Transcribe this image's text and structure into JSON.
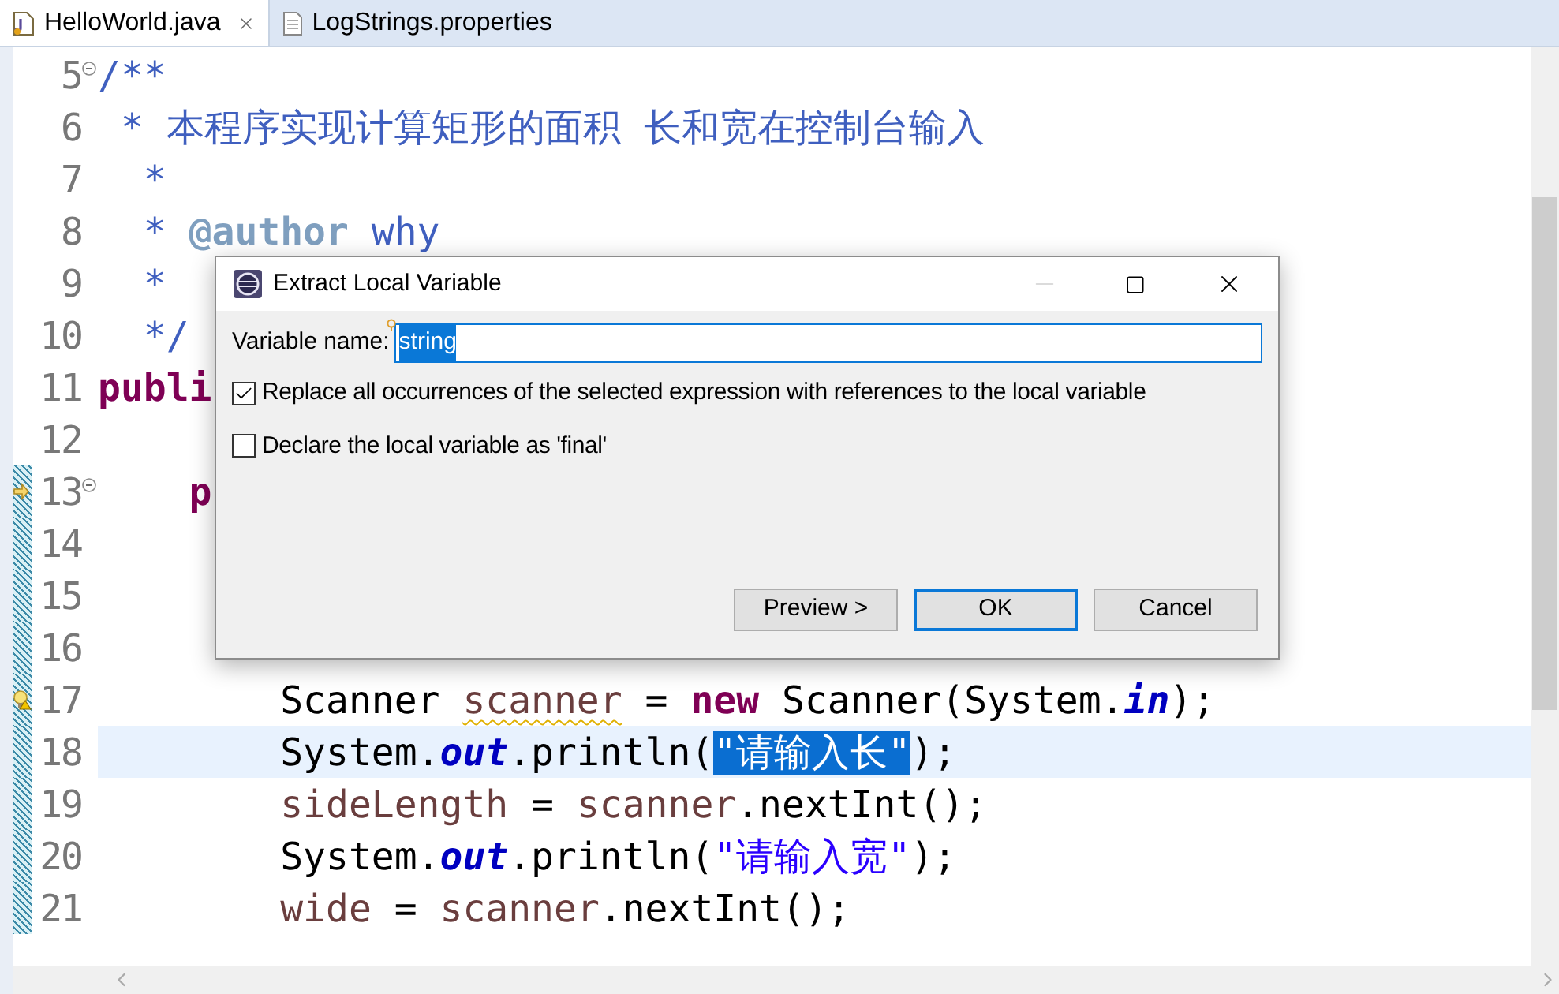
{
  "tabs": [
    {
      "label": "HelloWorld.java",
      "selected": true,
      "kind": "java",
      "closable": true
    },
    {
      "label": "LogStrings.properties",
      "selected": false,
      "kind": "properties",
      "closable": false
    }
  ],
  "editor": {
    "lines": [
      {
        "number": "5",
        "kind": "plain",
        "fold": true,
        "changed": false,
        "current": false,
        "tokens": [
          {
            "text": "/**",
            "kind": "javadoc"
          }
        ]
      },
      {
        "number": "6",
        "kind": "plain",
        "fold": false,
        "changed": false,
        "current": false,
        "tokens": [
          {
            "text": " * 本程序实现计算矩形的面积 长和宽在控制台输入",
            "kind": "javadoc"
          }
        ]
      },
      {
        "number": "7",
        "kind": "plain",
        "fold": false,
        "changed": false,
        "current": false,
        "tokens": [
          {
            "text": "  *",
            "kind": "javadoc"
          }
        ]
      },
      {
        "number": "8",
        "kind": "plain",
        "fold": false,
        "changed": false,
        "current": false,
        "tokens": [
          {
            "text": "  * ",
            "kind": "javadoc"
          },
          {
            "text": "@author",
            "kind": "tag"
          },
          {
            "text": " why",
            "kind": "javadoc"
          }
        ]
      },
      {
        "number": "9",
        "kind": "plain",
        "fold": false,
        "changed": false,
        "current": false,
        "tokens": [
          {
            "text": "  *",
            "kind": "javadoc"
          }
        ]
      },
      {
        "number": "10",
        "kind": "plain",
        "fold": false,
        "changed": false,
        "current": false,
        "tokens": [
          {
            "text": "  */",
            "kind": "javadoc"
          }
        ]
      },
      {
        "number": "11",
        "kind": "plain",
        "fold": false,
        "changed": false,
        "current": false,
        "tokens": [
          {
            "text": "publi",
            "kind": "keyword"
          }
        ]
      },
      {
        "number": "12",
        "kind": "plain",
        "fold": false,
        "changed": false,
        "current": false
      },
      {
        "number": "13",
        "kind": "arrow",
        "fold": true,
        "changed": true,
        "current": false,
        "tokens": [
          {
            "text": "    p",
            "kind": "keyword"
          }
        ]
      },
      {
        "number": "14",
        "kind": "plain",
        "fold": false,
        "changed": true,
        "current": false
      },
      {
        "number": "15",
        "kind": "plain",
        "fold": false,
        "changed": true,
        "current": false
      },
      {
        "number": "16",
        "kind": "plain",
        "fold": false,
        "changed": true,
        "current": false
      },
      {
        "number": "17",
        "kind": "warning",
        "fold": false,
        "changed": true,
        "current": false,
        "tokens": [
          {
            "text": "        Scanner ",
            "kind": "plain"
          },
          {
            "text": "scanner",
            "kind": "local",
            "warning": true
          },
          {
            "text": " = ",
            "kind": "plain"
          },
          {
            "text": "new",
            "kind": "keyword"
          },
          {
            "text": " Scanner(System.",
            "kind": "plain"
          },
          {
            "text": "in",
            "kind": "field"
          },
          {
            "text": ");",
            "kind": "plain"
          }
        ]
      },
      {
        "number": "18",
        "kind": "plain",
        "fold": false,
        "changed": true,
        "current": true,
        "tokens": [
          {
            "text": "        System.",
            "kind": "plain"
          },
          {
            "text": "out",
            "kind": "field"
          },
          {
            "text": ".println(",
            "kind": "plain"
          },
          {
            "text": "\"请输入长\"",
            "kind": "string",
            "selected": true
          },
          {
            "text": ");",
            "kind": "plain"
          }
        ]
      },
      {
        "number": "19",
        "kind": "plain",
        "fold": false,
        "changed": true,
        "current": false,
        "tokens": [
          {
            "text": "        sideLength",
            "kind": "local"
          },
          {
            "text": " = ",
            "kind": "plain"
          },
          {
            "text": "scanner",
            "kind": "local"
          },
          {
            "text": ".nextInt();",
            "kind": "plain"
          }
        ]
      },
      {
        "number": "20",
        "kind": "plain",
        "fold": false,
        "changed": true,
        "current": false,
        "tokens": [
          {
            "text": "        System.",
            "kind": "plain"
          },
          {
            "text": "out",
            "kind": "field"
          },
          {
            "text": ".println(",
            "kind": "plain"
          },
          {
            "text": "\"请输入宽\"",
            "kind": "string"
          },
          {
            "text": ");",
            "kind": "plain"
          }
        ]
      },
      {
        "number": "21",
        "kind": "plain",
        "fold": false,
        "changed": true,
        "current": false,
        "tokens": [
          {
            "text": "        wide",
            "kind": "local"
          },
          {
            "text": " = ",
            "kind": "plain"
          },
          {
            "text": "scanner",
            "kind": "local"
          },
          {
            "text": ".nextInt();",
            "kind": "plain"
          }
        ]
      }
    ]
  },
  "dialog": {
    "title": "Extract Local Variable",
    "field": {
      "label": "Variable name:",
      "value": "string",
      "selected": true
    },
    "options": [
      {
        "label": "Replace all occurrences of the selected expression with references to the local variable",
        "checked": true
      },
      {
        "label": "Declare the local variable as 'final'",
        "checked": false
      }
    ],
    "buttons": [
      {
        "label": "Preview >",
        "default": false
      },
      {
        "label": "OK",
        "default": true
      },
      {
        "label": "Cancel",
        "default": false
      }
    ]
  }
}
